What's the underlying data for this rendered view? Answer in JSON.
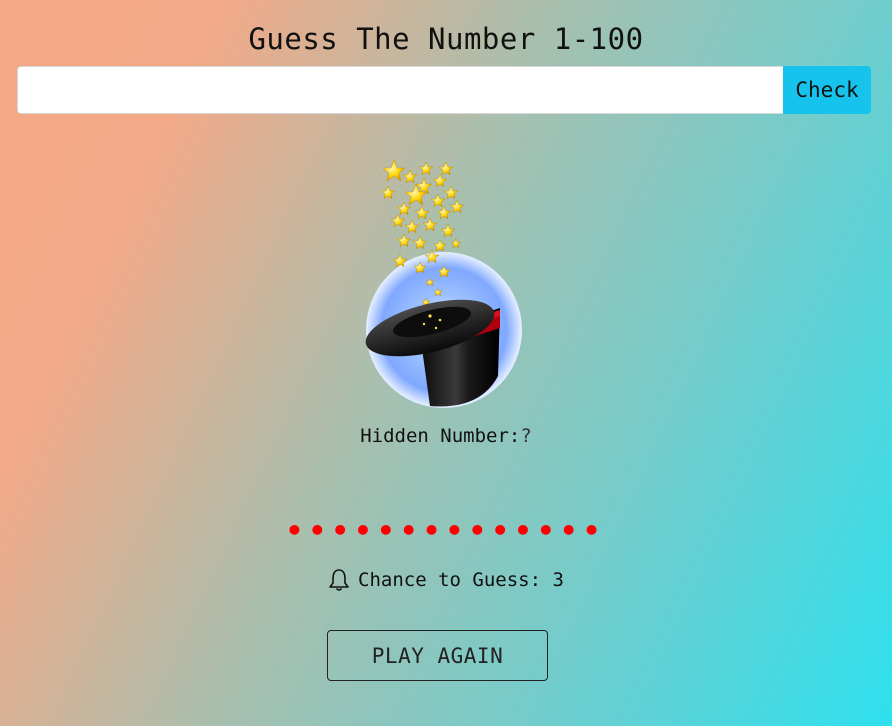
{
  "title": "Guess The Number 1-100",
  "input": {
    "value": "",
    "placeholder": ""
  },
  "check_label": "Check",
  "hidden": {
    "label": "Hidden Number:",
    "value": "?"
  },
  "dots": "••••••••••••••",
  "chance": {
    "label": "Chance to Guess: ",
    "value": "3"
  },
  "play_again_label": "PLAY AGAIN",
  "colors": {
    "check_button": "#15c3ec",
    "dots": "#ff0000"
  },
  "icons": {
    "hat": "magic-hat-icon",
    "bell": "bell-icon"
  }
}
